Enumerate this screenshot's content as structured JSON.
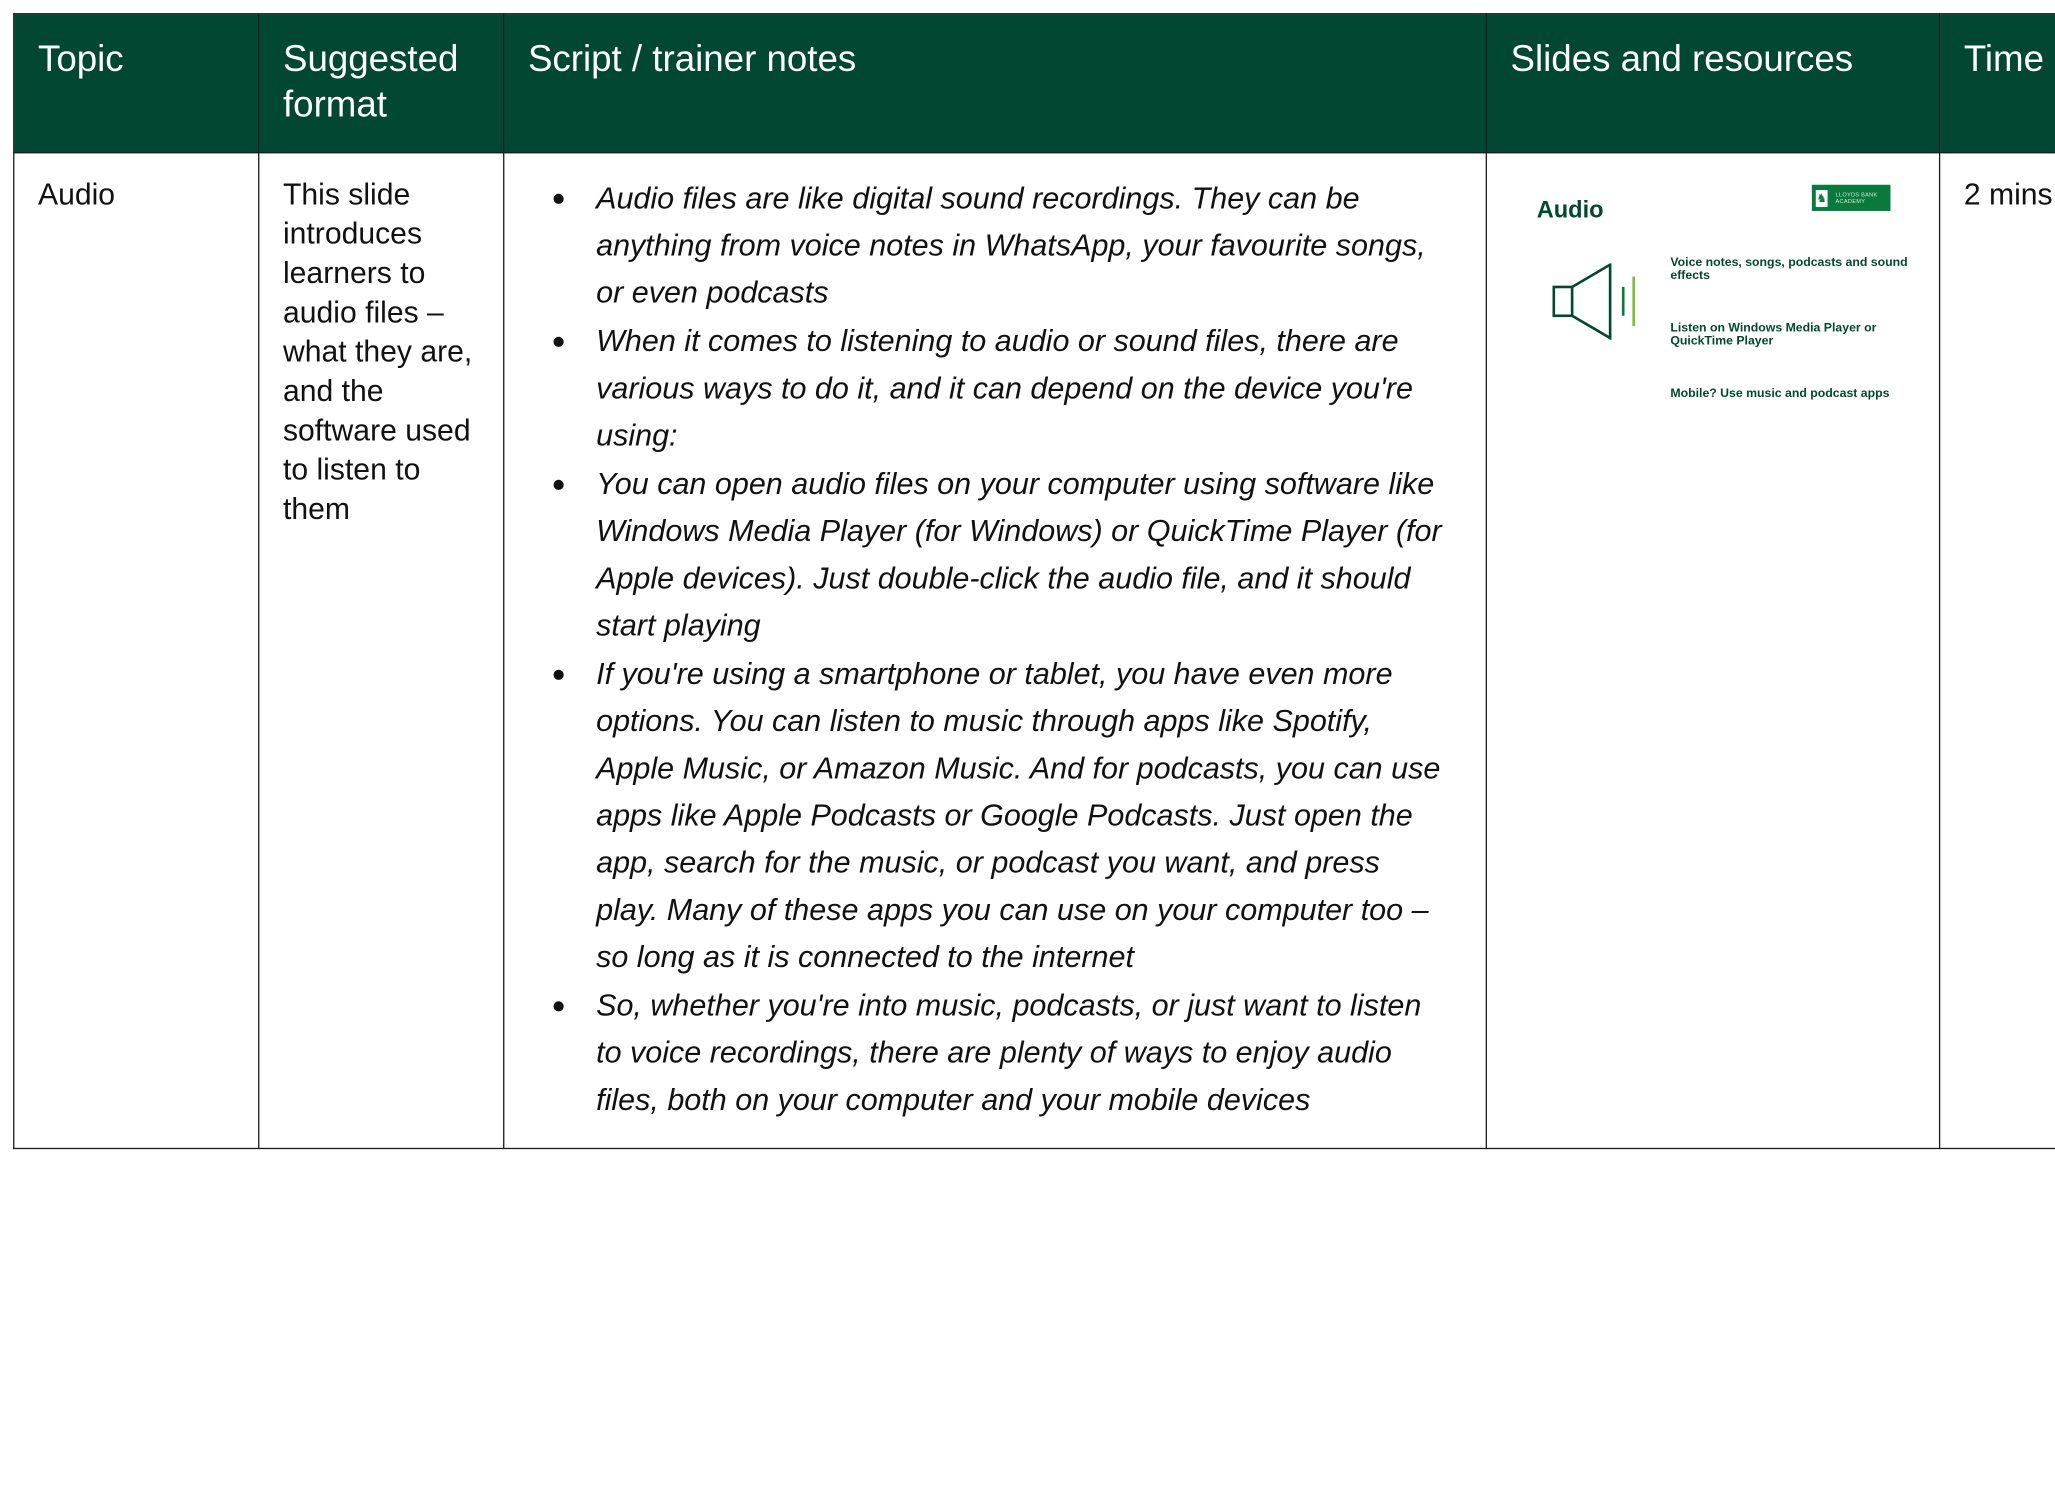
{
  "table": {
    "headers": {
      "topic": "Topic",
      "format": "Suggested format",
      "script": "Script / trainer notes",
      "slides": "Slides and resources",
      "time": "Time"
    },
    "row": {
      "topic": "Audio",
      "format": "This slide introduces learners to audio files – what they are, and the software used to listen to them",
      "script_notes": [
        " Audio files are like digital sound recordings. They can be anything from voice notes in WhatsApp, your favourite songs, or even podcasts",
        "When it comes to listening to audio or sound files, there are various ways to do it, and it can depend on the device you're using:",
        "You can open audio files on your computer using software like Windows Media Player (for Windows) or QuickTime Player (for Apple devices). Just double-click the audio file, and it should start playing",
        "If you're using a smartphone or tablet, you have even more options. You can listen to music through apps like Spotify, Apple Music, or Amazon Music. And for podcasts, you can use apps like Apple Podcasts or Google Podcasts. Just open the app, search for the music, or podcast you want, and press play. Many of these apps you can use on your computer too – so long as it is connected to the internet",
        "So, whether you're into music, podcasts, or just want to listen to voice recordings, there are plenty of ways to enjoy audio files, both on your computer and your mobile devices"
      ],
      "time": "2 mins"
    }
  },
  "slide_thumbnail": {
    "title": "Audio",
    "logo_text": "LLOYDS BANK ACADEMY",
    "icon": "speaker-icon",
    "lines": [
      "Voice notes, songs, podcasts and sound effects",
      "Listen on Windows Media Player or QuickTime Player",
      "Mobile? Use music and podcast apps"
    ]
  },
  "colors": {
    "header_bg": "#024731",
    "header_text": "#ffffff",
    "accent_green": "#0a7a3c",
    "border": "#1d1d1d"
  }
}
